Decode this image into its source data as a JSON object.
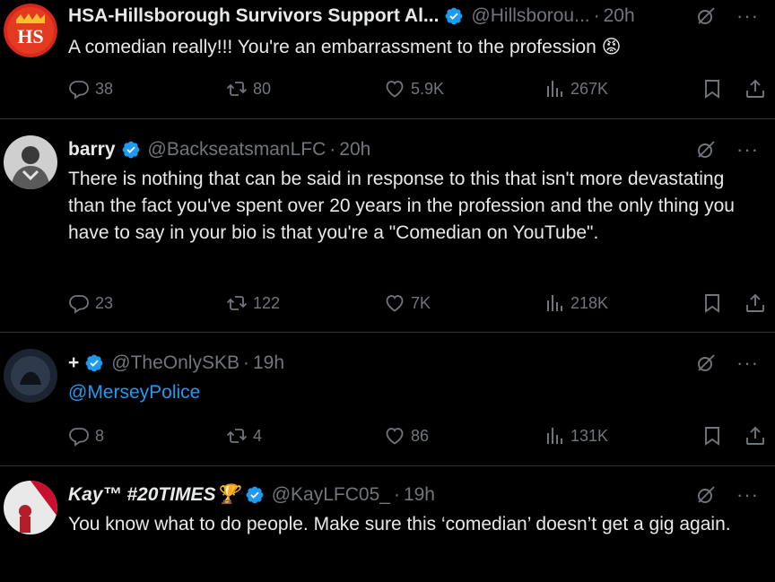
{
  "tweets": [
    {
      "name": "HSA-Hillsborough Survivors Support Al...",
      "handle": "@Hillsborou...",
      "time": "20h",
      "text": "A comedian really!!! You're an embarrassment to the profession 😡",
      "replies": "38",
      "retweets": "80",
      "likes": "5.9K",
      "views": "267K"
    },
    {
      "name": "barry",
      "handle": "@BackseatsmanLFC",
      "time": "20h",
      "text": "There is nothing that can be said in response to this that isn't more devastating than the fact you've spent over 20 years in the profession and the only thing you have to say in your bio is that you're a \"Comedian on YouTube\".",
      "replies": "23",
      "retweets": "122",
      "likes": "7K",
      "views": "218K"
    },
    {
      "name": "+",
      "handle": "@TheOnlySKB",
      "time": "19h",
      "text": "@MerseyPolice",
      "replies": "8",
      "retweets": "4",
      "likes": "86",
      "views": "131K"
    },
    {
      "name": "Kay™ #20TIMES🏆",
      "handle": "@KayLFC05_",
      "time": "19h",
      "text": "You know what to do people. Make sure this ‘comedian’ doesn’t get a gig again."
    }
  ],
  "colors": {
    "background": "#000000",
    "text": "#e7e9ea",
    "muted": "#71767b",
    "accent": "#1d9bf0",
    "divider": "#2f3336"
  },
  "icons": [
    "verified-badge-icon",
    "reply-icon",
    "retweet-icon",
    "like-icon",
    "views-icon",
    "bookmark-icon",
    "share-icon",
    "grok-icon",
    "more-icon"
  ]
}
